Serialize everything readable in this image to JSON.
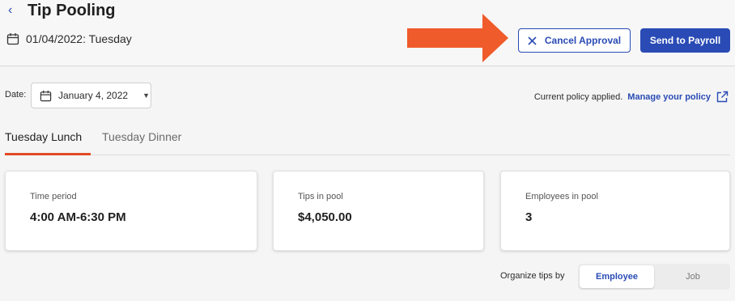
{
  "header": {
    "back_glyph": "‹",
    "title": "Tip Pooling",
    "date_text": "01/04/2022: Tuesday",
    "cancel_label": "Cancel Approval",
    "payroll_label": "Send to Payroll"
  },
  "filters": {
    "date_label": "Date:",
    "date_value": "January 4, 2022",
    "policy_text": "Current policy applied.",
    "policy_link": "Manage your policy"
  },
  "tabs": [
    {
      "label": "Tuesday Lunch"
    },
    {
      "label": "Tuesday Dinner"
    }
  ],
  "cards": [
    {
      "label": "Time period",
      "value": "4:00 AM-6:30 PM"
    },
    {
      "label": "Tips in pool",
      "value": "$4,050.00"
    },
    {
      "label": "Employees in pool",
      "value": "3"
    }
  ],
  "organize": {
    "label": "Organize tips by",
    "options": [
      "Employee",
      "Job"
    ]
  },
  "colors": {
    "accent": "#2a4bb5",
    "tab_underline": "#e24b26",
    "annotation_arrow": "#ef5b2a"
  }
}
